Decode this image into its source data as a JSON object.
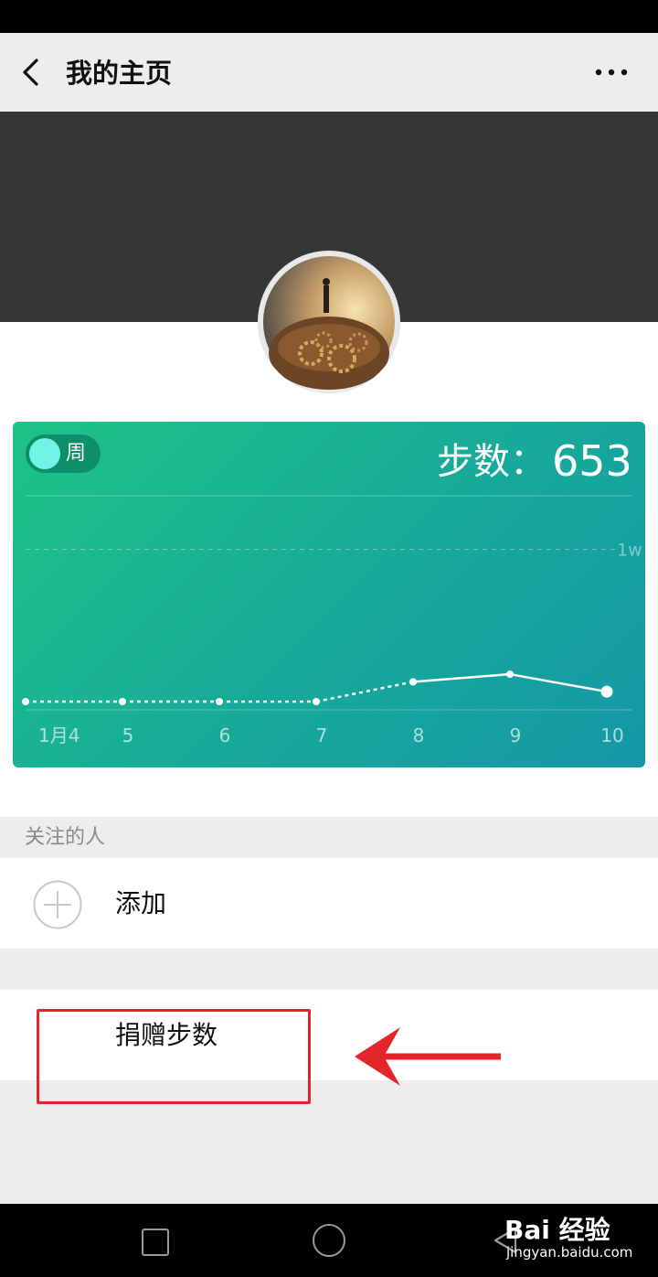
{
  "nav": {
    "title": "我的主页",
    "back_icon": "chevron-left-icon",
    "more_icon": "more-dots-icon"
  },
  "profile": {
    "avatar_icon": "avatar-image"
  },
  "card": {
    "toggle_label": "周",
    "steps_label": "步数：",
    "steps_value": "653",
    "colors": {
      "gradient_start": "#1ec386",
      "gradient_end": "#1597a6"
    }
  },
  "chart_data": {
    "type": "line",
    "categories": [
      "1月4",
      "5",
      "6",
      "7",
      "8",
      "9",
      "10"
    ],
    "values": [
      0,
      0,
      0,
      0,
      1300,
      1800,
      653
    ],
    "reference_line": {
      "label": "1w",
      "value": 10000
    },
    "ylim": [
      0,
      12500
    ],
    "dashed_until_index": 4,
    "grid": false
  },
  "following": {
    "header": "关注的人",
    "add_label": "添加",
    "add_icon": "plus-circle-icon"
  },
  "donate": {
    "label": "捐赠步数"
  },
  "annotation": {
    "box_color": "#e3242b",
    "arrow_color": "#e3242b"
  },
  "system_nav": {
    "recent_icon": "square-icon",
    "home_icon": "circle-icon",
    "back_icon": "triangle-back-icon"
  },
  "watermark": {
    "brand": "Bai 经验",
    "sub": "jingyan.baidu.com"
  }
}
